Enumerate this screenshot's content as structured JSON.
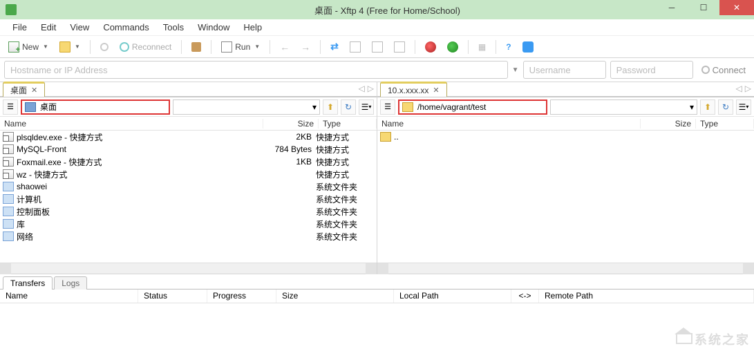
{
  "window": {
    "title": "桌面 - Xftp 4 (Free for Home/School)"
  },
  "menu": {
    "file": "File",
    "edit": "Edit",
    "view": "View",
    "commands": "Commands",
    "tools": "Tools",
    "window": "Window",
    "help": "Help"
  },
  "toolbar": {
    "new": "New",
    "reconnect": "Reconnect",
    "run": "Run",
    "connect": "Connect"
  },
  "connect": {
    "host_placeholder": "Hostname or IP Address",
    "user_placeholder": "Username",
    "pass_placeholder": "Password"
  },
  "left": {
    "tab_label": "桌面",
    "path_text": "桌面",
    "cols": {
      "name": "Name",
      "size": "Size",
      "type": "Type"
    },
    "rows": [
      {
        "icon": "fi-shortcut",
        "name": "plsqldev.exe - 快捷方式",
        "size": "2KB",
        "type": "快捷方式"
      },
      {
        "icon": "fi-shortcut",
        "name": "MySQL-Front",
        "size": "784 Bytes",
        "type": "快捷方式"
      },
      {
        "icon": "fi-shortcut",
        "name": "Foxmail.exe - 快捷方式",
        "size": "1KB",
        "type": "快捷方式"
      },
      {
        "icon": "fi-shortcut",
        "name": "wz - 快捷方式",
        "size": "",
        "type": "快捷方式"
      },
      {
        "icon": "fi-sysfolder",
        "name": "shaowei",
        "size": "",
        "type": "系统文件夹"
      },
      {
        "icon": "fi-sysfolder",
        "name": "计算机",
        "size": "",
        "type": "系统文件夹"
      },
      {
        "icon": "fi-sysfolder",
        "name": "控制面板",
        "size": "",
        "type": "系统文件夹"
      },
      {
        "icon": "fi-sysfolder",
        "name": "库",
        "size": "",
        "type": "系统文件夹"
      },
      {
        "icon": "fi-sysfolder",
        "name": "网络",
        "size": "",
        "type": "系统文件夹"
      }
    ]
  },
  "right": {
    "tab_label": "10.x.xxx.xx",
    "path_text": "/home/vagrant/test",
    "cols": {
      "name": "Name",
      "size": "Size",
      "type": "Type"
    },
    "rows": [
      {
        "icon": "fi-folder",
        "name": "..",
        "size": "",
        "type": ""
      }
    ]
  },
  "bottom": {
    "tab_transfers": "Transfers",
    "tab_logs": "Logs",
    "cols": {
      "name": "Name",
      "status": "Status",
      "progress": "Progress",
      "size": "Size",
      "local": "Local Path",
      "arrow": "<->",
      "remote": "Remote Path"
    }
  }
}
